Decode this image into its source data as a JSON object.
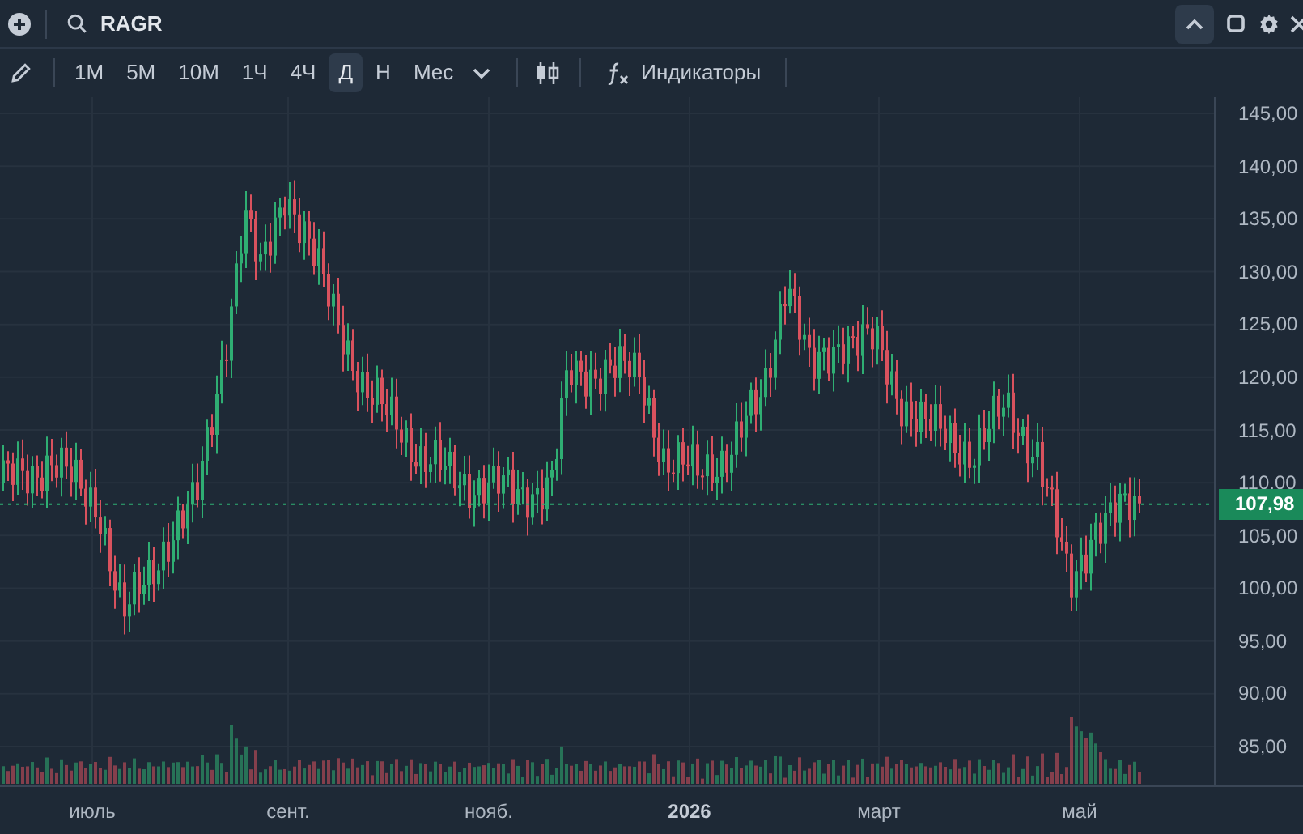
{
  "search": {
    "value": "RAGR"
  },
  "timeframes": [
    {
      "label": "1M",
      "selected": false
    },
    {
      "label": "5M",
      "selected": false
    },
    {
      "label": "10M",
      "selected": false
    },
    {
      "label": "1Ч",
      "selected": false
    },
    {
      "label": "4Ч",
      "selected": false
    },
    {
      "label": "Д",
      "selected": true
    },
    {
      "label": "Н",
      "selected": false
    },
    {
      "label": "Мес",
      "selected": false
    }
  ],
  "indicators_button": {
    "label": "Индикаторы"
  },
  "price_axis": {
    "ticks": [
      "145,00",
      "140,00",
      "135,00",
      "130,00",
      "125,00",
      "120,00",
      "115,00",
      "110,00",
      "105,00",
      "100,00",
      "95,00",
      "90,00",
      "85,00"
    ]
  },
  "last_price": {
    "label": "107,98"
  },
  "time_axis": {
    "labels": [
      "июль",
      "сент.",
      "нояб.",
      "2026",
      "март",
      "май"
    ]
  }
}
